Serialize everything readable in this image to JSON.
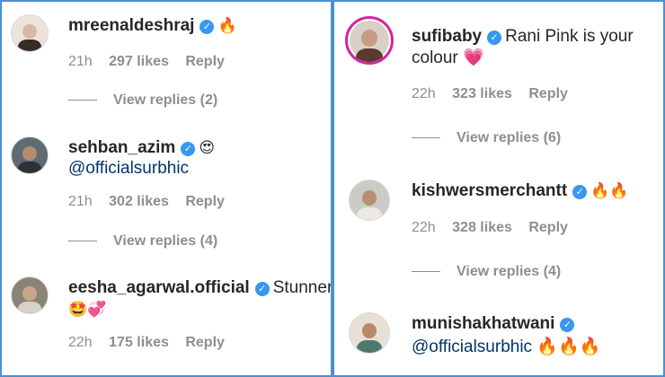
{
  "left": [
    {
      "username": "mreenaldeshraj",
      "text": "🔥",
      "time": "21h",
      "likes": "297 likes",
      "reply": "Reply",
      "view_replies": "View replies (2)"
    },
    {
      "username": "sehban_azim",
      "text": "😍",
      "text2": "@officialsurbhic",
      "time": "21h",
      "likes": "302 likes",
      "reply": "Reply",
      "view_replies": "View replies (4)"
    },
    {
      "username": "eesha_agarwal.official",
      "text": "Stunner",
      "text2": "🤩💞",
      "time": "22h",
      "likes": "175 likes",
      "reply": "Reply"
    }
  ],
  "right": [
    {
      "username": "sufibaby",
      "text": "Rani Pink is your",
      "text2": "colour 💗",
      "time": "22h",
      "likes": "323 likes",
      "reply": "Reply",
      "view_replies": "View replies (6)"
    },
    {
      "username": "kishwersmerchantt",
      "text": "🔥🔥",
      "time": "22h",
      "likes": "328 likes",
      "reply": "Reply",
      "view_replies": "View replies (4)"
    },
    {
      "username": "munishakhatwani",
      "text": "",
      "text2": "@officialsurbhic 🔥🔥🔥"
    }
  ],
  "icons": {
    "verified": "verified-badge-icon",
    "verified_glyph": "✓",
    "verified_color": "#3897f0"
  },
  "colors": {
    "border": "#4a90d9",
    "muted": "#8e8e8e",
    "text": "#262626",
    "mention": "#003569"
  }
}
